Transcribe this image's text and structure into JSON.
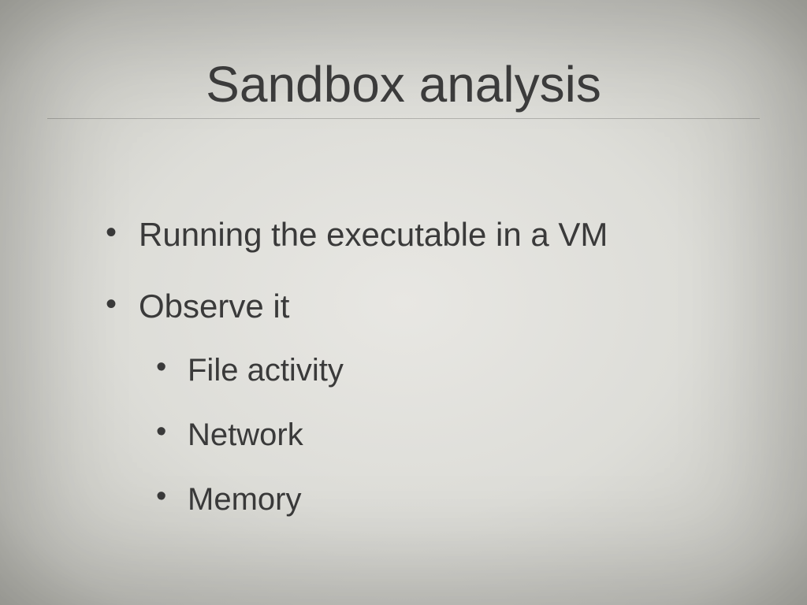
{
  "slide": {
    "title": "Sandbox analysis",
    "bullets": [
      {
        "text": "Running the executable in a VM"
      },
      {
        "text": "Observe it",
        "sub": [
          {
            "text": "File activity"
          },
          {
            "text": "Network"
          },
          {
            "text": "Memory"
          }
        ]
      }
    ]
  }
}
